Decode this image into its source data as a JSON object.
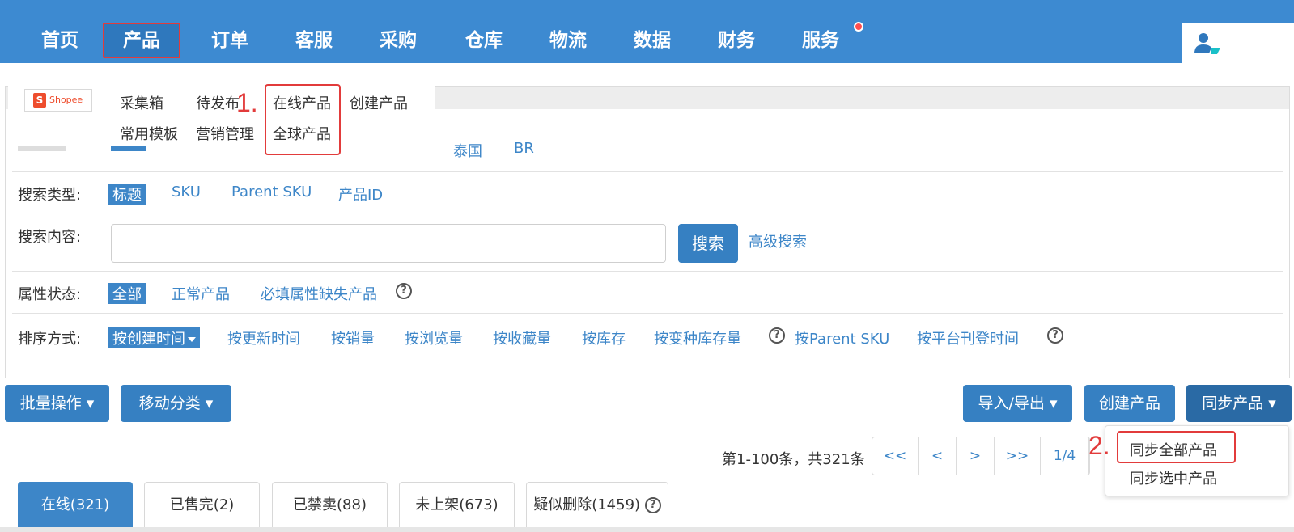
{
  "nav": {
    "items": [
      "首页",
      "产品",
      "订单",
      "客服",
      "采购",
      "仓库",
      "物流",
      "数据",
      "财务",
      "服务"
    ],
    "active_index": 1
  },
  "colors": {
    "primary": "#3d8ad1",
    "accent": "#3680c2",
    "annotation": "#e23b3b"
  },
  "submenu": {
    "logo_text": "Shopee",
    "row1": [
      "采集箱",
      "待发布",
      "在线产品",
      "创建产品"
    ],
    "row2": [
      "常用模板",
      "营销管理",
      "全球产品"
    ]
  },
  "annotations": {
    "step1": "1.",
    "step2": "2."
  },
  "filters": {
    "site_options": [
      "泰国",
      "BR"
    ],
    "search_type": {
      "label": "搜索类型:",
      "options": [
        "标题",
        "SKU",
        "Parent SKU",
        "产品ID"
      ]
    },
    "search_content": {
      "label": "搜索内容:",
      "value": "",
      "button": "搜索",
      "advanced": "高级搜索"
    },
    "attr_status": {
      "label": "属性状态:",
      "options": [
        "全部",
        "正常产品",
        "必填属性缺失产品"
      ]
    },
    "sort": {
      "label": "排序方式:",
      "options": [
        "按创建时间",
        "按更新时间",
        "按销量",
        "按浏览量",
        "按收藏量",
        "按库存",
        "按变种库存量",
        "按Parent SKU",
        "按平台刊登时间"
      ]
    }
  },
  "actions": {
    "batch": "批量操作",
    "move": "移动分类",
    "import_export": "导入/导出",
    "create": "创建产品",
    "sync": "同步产品"
  },
  "sync_menu": [
    "同步全部产品",
    "同步选中产品"
  ],
  "pagination": {
    "count_text": "第1-100条，共321条",
    "buttons": [
      "<<",
      "<",
      ">",
      ">>",
      "1/4"
    ]
  },
  "tabs": [
    "在线(321)",
    "已售完(2)",
    "已禁卖(88)",
    "未上架(673)",
    "疑似删除(1459)"
  ]
}
